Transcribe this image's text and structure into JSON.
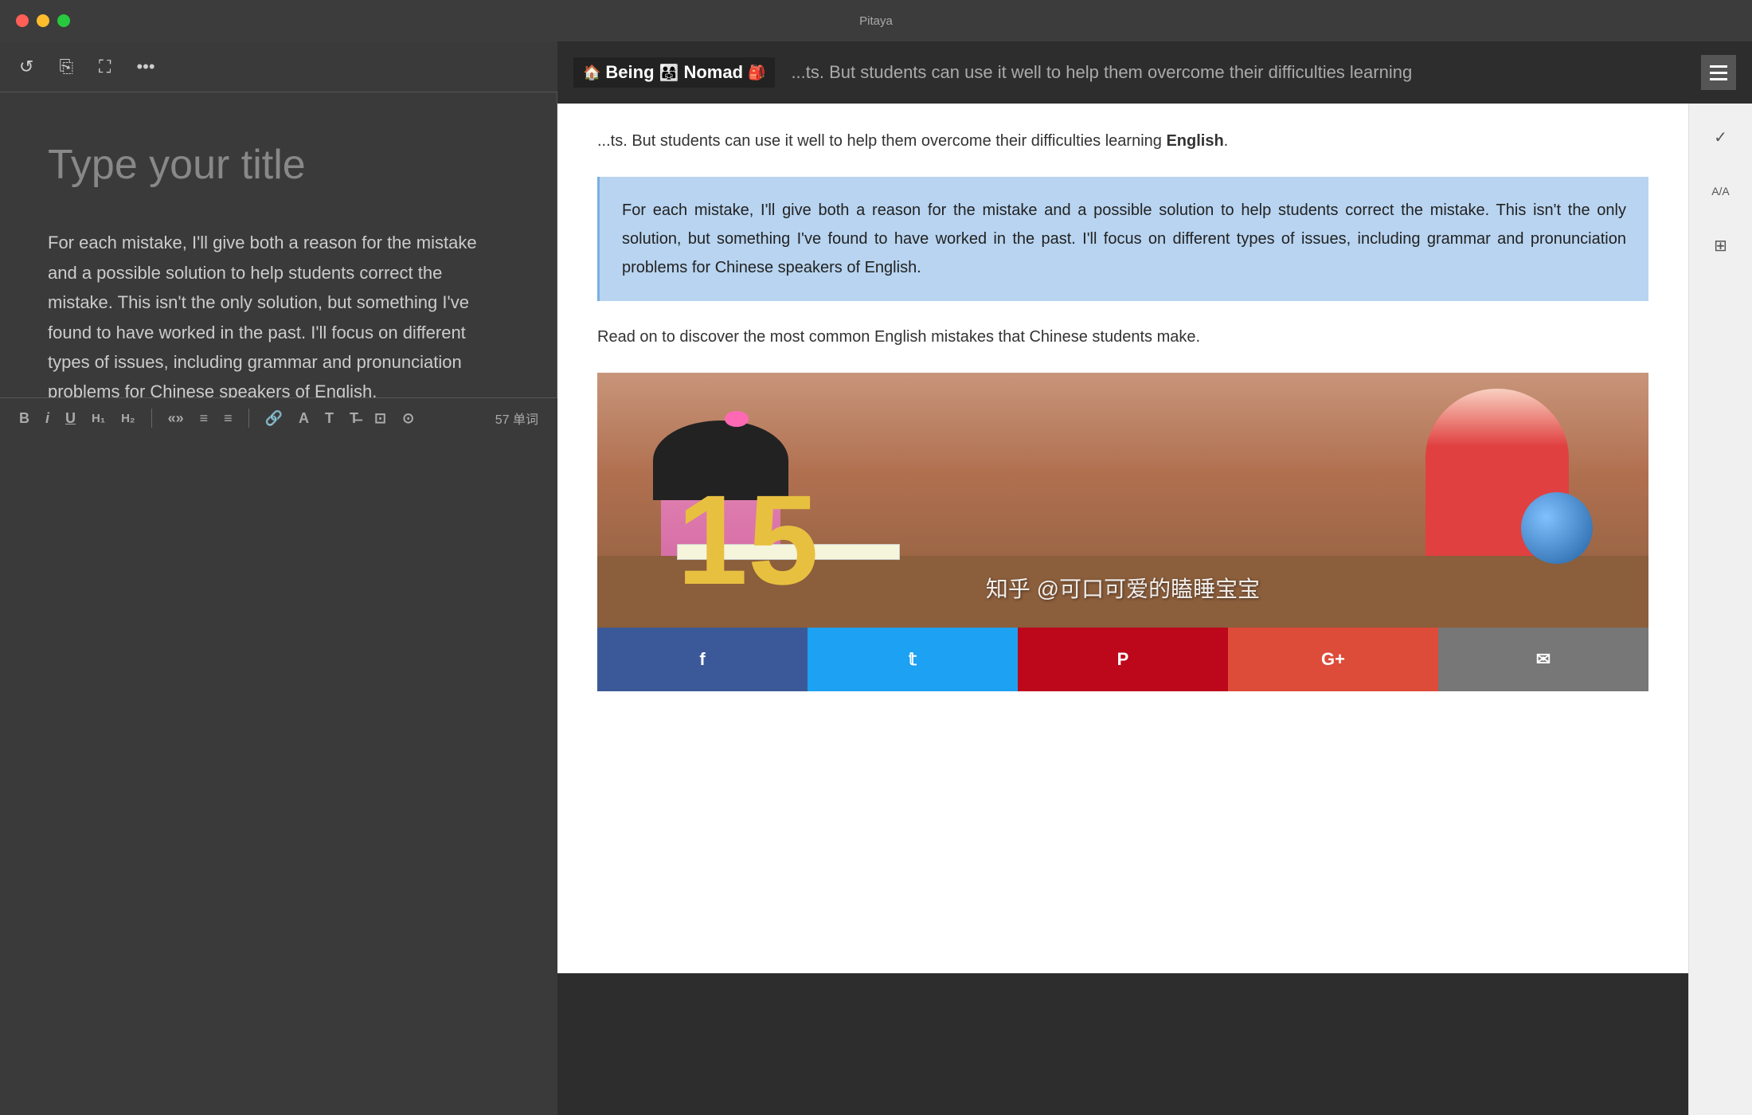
{
  "app": {
    "title": "Pitaya",
    "window_controls": {
      "close": "●",
      "minimize": "●",
      "maximize": "●"
    }
  },
  "toolbar": {
    "icons": [
      "↺",
      "⎘",
      "⛶",
      "•••"
    ]
  },
  "editor": {
    "title_placeholder": "Type your title",
    "body_text": "For each mistake, I'll give both a reason for the mistake and a possible solution to help students correct the mistake. This isn't the only solution, but something I've found to have worked in the past. I'll focus on different types of issues, including grammar and pronunciation problems for Chinese speakers of English."
  },
  "browser": {
    "logo_text": "Being",
    "logo_suffix": "Nomad",
    "nav_dots": "≡",
    "content": {
      "intro_text": "students can use it well to help them overcome their difficulties learning English.",
      "highlighted_text": "For each mistake, I'll give both a reason for the mistake and a possible solution to help students correct the mistake. This isn't the only solution, but something I've found to have worked in the past. I'll focus on different types of issues, including grammar and pronunciation problems for Chinese speakers of English.",
      "read_on_text": "Read on to discover the most common English mistakes that Chinese students make."
    },
    "image": {
      "big_number": "15",
      "watermark": "知乎 @可口可爱的瞌睡宝宝"
    },
    "social": {
      "facebook": "f",
      "twitter": "t",
      "pinterest": "P",
      "googleplus": "G+",
      "email": "✉"
    }
  },
  "sidebar": {
    "icons": [
      "✓",
      "+/A",
      "⊞"
    ]
  },
  "bottom_toolbar": {
    "bold": "B",
    "italic": "i",
    "underline": "U",
    "h1": "H₁",
    "h2": "H₂",
    "quote": "«»",
    "list_ul": "≡",
    "list_ol": "≡",
    "link": "🔗",
    "text": "A",
    "type": "T",
    "strikethrough": "T̶",
    "image": "⊡",
    "clock": "⊙",
    "word_count": "57 单词"
  }
}
